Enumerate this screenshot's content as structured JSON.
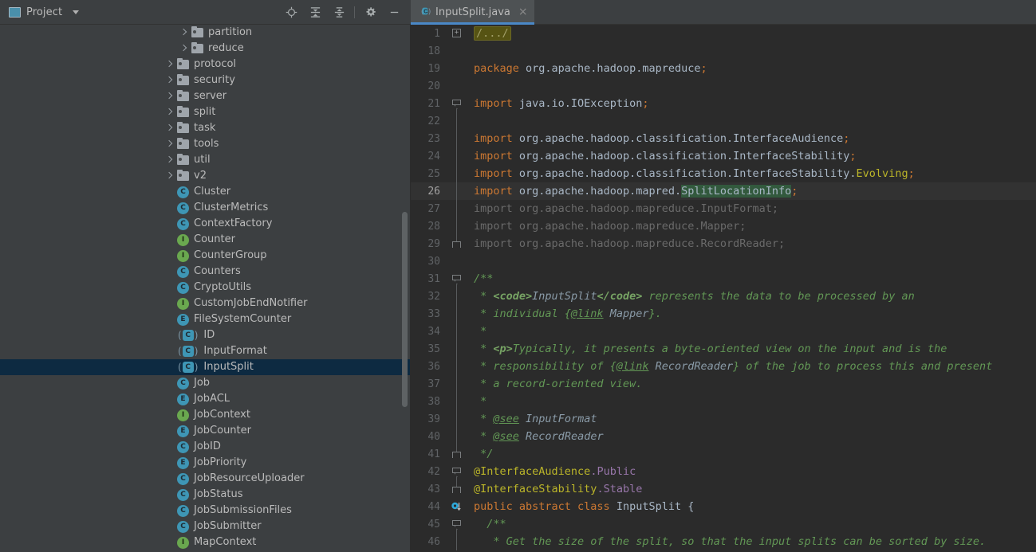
{
  "window": {
    "panel_title": "Project",
    "panel_icon": "project-window-icon"
  },
  "toolbar": {
    "icons": [
      {
        "name": "locate-target-icon",
        "title": "Select Opened File"
      },
      {
        "name": "expand-all-icon",
        "title": "Expand All"
      },
      {
        "name": "collapse-all-icon",
        "title": "Collapse All"
      },
      {
        "name": "gear-icon",
        "title": "Settings"
      },
      {
        "name": "minimize-icon",
        "title": "Hide"
      }
    ]
  },
  "tabs": [
    {
      "label": "InputSplit.java",
      "icon": "abstract-class-icon",
      "active": true,
      "close": "×"
    }
  ],
  "sidebar": {
    "items": [
      {
        "label": "partition",
        "kind": "folder",
        "indent": 2,
        "arrow": true
      },
      {
        "label": "reduce",
        "kind": "folder",
        "indent": 2,
        "arrow": true
      },
      {
        "label": "protocol",
        "kind": "folder",
        "indent": 1,
        "arrow": true
      },
      {
        "label": "security",
        "kind": "folder",
        "indent": 1,
        "arrow": true
      },
      {
        "label": "server",
        "kind": "folder",
        "indent": 1,
        "arrow": true
      },
      {
        "label": "split",
        "kind": "folder",
        "indent": 1,
        "arrow": true
      },
      {
        "label": "task",
        "kind": "folder",
        "indent": 1,
        "arrow": true
      },
      {
        "label": "tools",
        "kind": "folder",
        "indent": 1,
        "arrow": true
      },
      {
        "label": "util",
        "kind": "folder",
        "indent": 1,
        "arrow": true
      },
      {
        "label": "v2",
        "kind": "folder",
        "indent": 1,
        "arrow": true
      },
      {
        "label": "Cluster",
        "kind": "class",
        "indent": 1,
        "arrow": false
      },
      {
        "label": "ClusterMetrics",
        "kind": "class",
        "indent": 1,
        "arrow": false
      },
      {
        "label": "ContextFactory",
        "kind": "class",
        "indent": 1,
        "arrow": false
      },
      {
        "label": "Counter",
        "kind": "interface",
        "indent": 1,
        "arrow": false
      },
      {
        "label": "CounterGroup",
        "kind": "interface",
        "indent": 1,
        "arrow": false
      },
      {
        "label": "Counters",
        "kind": "class",
        "indent": 1,
        "arrow": false
      },
      {
        "label": "CryptoUtils",
        "kind": "class",
        "indent": 1,
        "arrow": false
      },
      {
        "label": "CustomJobEndNotifier",
        "kind": "interface",
        "indent": 1,
        "arrow": false
      },
      {
        "label": "FileSystemCounter",
        "kind": "enum",
        "indent": 1,
        "arrow": false
      },
      {
        "label": "ID",
        "kind": "abstract",
        "indent": 1,
        "arrow": false
      },
      {
        "label": "InputFormat",
        "kind": "abstract",
        "indent": 1,
        "arrow": false
      },
      {
        "label": "InputSplit",
        "kind": "abstract",
        "indent": 1,
        "arrow": false,
        "selected": true
      },
      {
        "label": "Job",
        "kind": "class",
        "indent": 1,
        "arrow": false
      },
      {
        "label": "JobACL",
        "kind": "enum",
        "indent": 1,
        "arrow": false
      },
      {
        "label": "JobContext",
        "kind": "interface",
        "indent": 1,
        "arrow": false
      },
      {
        "label": "JobCounter",
        "kind": "enum",
        "indent": 1,
        "arrow": false
      },
      {
        "label": "JobID",
        "kind": "class",
        "indent": 1,
        "arrow": false
      },
      {
        "label": "JobPriority",
        "kind": "enum",
        "indent": 1,
        "arrow": false
      },
      {
        "label": "JobResourceUploader",
        "kind": "class",
        "indent": 1,
        "arrow": false
      },
      {
        "label": "JobStatus",
        "kind": "class",
        "indent": 1,
        "arrow": false
      },
      {
        "label": "JobSubmissionFiles",
        "kind": "class",
        "indent": 1,
        "arrow": false
      },
      {
        "label": "JobSubmitter",
        "kind": "class",
        "indent": 1,
        "arrow": false
      },
      {
        "label": "MapContext",
        "kind": "interface",
        "indent": 1,
        "arrow": false
      }
    ]
  },
  "editor": {
    "current_line": 26,
    "lines": [
      {
        "n": "1",
        "fold": "plus",
        "tokens": [
          {
            "t": "/.../",
            "c": "fold-txt"
          }
        ]
      },
      {
        "n": "18",
        "fold": "none",
        "tokens": []
      },
      {
        "n": "19",
        "fold": "none",
        "tokens": [
          {
            "t": "package ",
            "c": "kw"
          },
          {
            "t": "org.apache.hadoop.mapreduce",
            "c": "txt"
          },
          {
            "t": ";",
            "c": "kw"
          }
        ]
      },
      {
        "n": "20",
        "fold": "none",
        "tokens": []
      },
      {
        "n": "21",
        "fold": "minus",
        "tokens": [
          {
            "t": "import ",
            "c": "kw"
          },
          {
            "t": "java.io.IOException",
            "c": "txt"
          },
          {
            "t": ";",
            "c": "kw"
          }
        ]
      },
      {
        "n": "22",
        "fold": "bar",
        "tokens": []
      },
      {
        "n": "23",
        "fold": "bar",
        "tokens": [
          {
            "t": "import ",
            "c": "kw"
          },
          {
            "t": "org.apache.hadoop.classification.InterfaceAudience",
            "c": "txt"
          },
          {
            "t": ";",
            "c": "kw"
          }
        ]
      },
      {
        "n": "24",
        "fold": "bar",
        "tokens": [
          {
            "t": "import ",
            "c": "kw"
          },
          {
            "t": "org.apache.hadoop.classification.InterfaceStability",
            "c": "txt"
          },
          {
            "t": ";",
            "c": "kw"
          }
        ]
      },
      {
        "n": "25",
        "fold": "bar",
        "tokens": [
          {
            "t": "import ",
            "c": "kw"
          },
          {
            "t": "org.apache.hadoop.classification.InterfaceStability.",
            "c": "txt"
          },
          {
            "t": "Evolving",
            "c": "evolv"
          },
          {
            "t": ";",
            "c": "kw"
          }
        ]
      },
      {
        "n": "26",
        "fold": "bar",
        "current": true,
        "tokens": [
          {
            "t": "import ",
            "c": "kw"
          },
          {
            "t": "org.apache.hadoop.mapred.",
            "c": "txt"
          },
          {
            "t": "SplitLocationInfo",
            "c": "txt hl-green"
          },
          {
            "t": ";",
            "c": "kw"
          }
        ]
      },
      {
        "n": "27",
        "fold": "bar",
        "tokens": [
          {
            "t": "import org.apache.hadoop.mapreduce.InputFormat;",
            "c": "dim"
          }
        ]
      },
      {
        "n": "28",
        "fold": "bar",
        "tokens": [
          {
            "t": "import org.apache.hadoop.mapreduce.Mapper;",
            "c": "dim"
          }
        ]
      },
      {
        "n": "29",
        "fold": "end",
        "tokens": [
          {
            "t": "import org.apache.hadoop.mapreduce.RecordReader;",
            "c": "dim"
          }
        ]
      },
      {
        "n": "30",
        "fold": "none",
        "tokens": []
      },
      {
        "n": "31",
        "fold": "minus",
        "tokens": [
          {
            "t": "/**",
            "c": "cm"
          }
        ]
      },
      {
        "n": "32",
        "fold": "bar",
        "tokens": [
          {
            "t": " * ",
            "c": "cm"
          },
          {
            "t": "<code>",
            "c": "cmb"
          },
          {
            "t": "InputSplit",
            "c": "cmref"
          },
          {
            "t": "</code>",
            "c": "cmb"
          },
          {
            "t": " represents the data to be processed by an",
            "c": "cm"
          }
        ]
      },
      {
        "n": "33",
        "fold": "bar",
        "tokens": [
          {
            "t": " * individual {",
            "c": "cm"
          },
          {
            "t": "@link",
            "c": "cmtag"
          },
          {
            "t": " ",
            "c": "cm"
          },
          {
            "t": "Mapper",
            "c": "cmref"
          },
          {
            "t": "}.",
            "c": "cm"
          }
        ]
      },
      {
        "n": "34",
        "fold": "bar",
        "tokens": [
          {
            "t": " *",
            "c": "cm"
          }
        ]
      },
      {
        "n": "35",
        "fold": "bar",
        "tokens": [
          {
            "t": " * ",
            "c": "cm"
          },
          {
            "t": "<p>",
            "c": "cmb"
          },
          {
            "t": "Typically, it presents a byte-oriented view on the input and is the",
            "c": "cm"
          }
        ]
      },
      {
        "n": "36",
        "fold": "bar",
        "tokens": [
          {
            "t": " * responsibility of {",
            "c": "cm"
          },
          {
            "t": "@link",
            "c": "cmtag"
          },
          {
            "t": " ",
            "c": "cm"
          },
          {
            "t": "RecordReader",
            "c": "cmref"
          },
          {
            "t": "} of the job to process this and present",
            "c": "cm"
          }
        ]
      },
      {
        "n": "37",
        "fold": "bar",
        "tokens": [
          {
            "t": " * a record-oriented view.",
            "c": "cm"
          }
        ]
      },
      {
        "n": "38",
        "fold": "bar",
        "tokens": [
          {
            "t": " *",
            "c": "cm"
          }
        ]
      },
      {
        "n": "39",
        "fold": "bar",
        "tokens": [
          {
            "t": " * ",
            "c": "cm"
          },
          {
            "t": "@see",
            "c": "cmtag"
          },
          {
            "t": " ",
            "c": "cm"
          },
          {
            "t": "InputFormat",
            "c": "cmref"
          }
        ]
      },
      {
        "n": "40",
        "fold": "bar",
        "tokens": [
          {
            "t": " * ",
            "c": "cm"
          },
          {
            "t": "@see",
            "c": "cmtag"
          },
          {
            "t": " ",
            "c": "cm"
          },
          {
            "t": "RecordReader",
            "c": "cmref"
          }
        ]
      },
      {
        "n": "41",
        "fold": "end",
        "tokens": [
          {
            "t": " */",
            "c": "cm"
          }
        ]
      },
      {
        "n": "42",
        "fold": "minus",
        "tokens": [
          {
            "t": "@InterfaceAudience",
            "c": "ann"
          },
          {
            "t": ".Public",
            "c": "annref"
          }
        ]
      },
      {
        "n": "43",
        "fold": "end",
        "tokens": [
          {
            "t": "@InterfaceStability",
            "c": "ann"
          },
          {
            "t": ".Stable",
            "c": "annref"
          }
        ]
      },
      {
        "n": "44",
        "fold": "none",
        "gutter_icon": "implemented-by-icon",
        "tokens": [
          {
            "t": "public abstract class ",
            "c": "kw"
          },
          {
            "t": "InputSplit",
            "c": "txt"
          },
          {
            "t": " {",
            "c": "txt"
          }
        ]
      },
      {
        "n": "45",
        "fold": "minus45",
        "tokens": [
          {
            "t": "  /**",
            "c": "cm"
          }
        ]
      },
      {
        "n": "46",
        "fold": "bar",
        "tokens": [
          {
            "t": "   * Get the size of the split, so that the input splits can be sorted by size.",
            "c": "cm"
          }
        ]
      }
    ]
  },
  "colors": {
    "editor_bg": "#2b2b2b",
    "sidebar_bg": "#3c3f41",
    "selection": "#0d2a41",
    "tab_accent": "#4a88c7",
    "keyword": "#cc7832",
    "comment": "#629755",
    "annotation": "#bbb529",
    "highlight_green": "#32593d"
  }
}
